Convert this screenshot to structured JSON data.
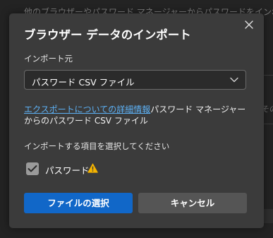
{
  "background": {
    "top_text": "他のブラウザーやパスワード マネージャーからパスワードをインポートする",
    "right_text": "その"
  },
  "dialog": {
    "title": "ブラウザー データのインポート",
    "close_icon": "close-icon",
    "source_label": "インポート元",
    "source_select": {
      "value": "パスワード CSV ファイル",
      "icon": "chevron-down-icon"
    },
    "description": {
      "link_text": "エクスポートについての詳細情報",
      "text": "パスワード マネージャーからのパスワード CSV ファイル"
    },
    "items_label": "インポートする項目を選択してください",
    "items": [
      {
        "label": "パスワード",
        "checked": true,
        "icon": "warning-icon"
      }
    ],
    "buttons": {
      "primary": "ファイルの選択",
      "secondary": "キャンセル"
    }
  },
  "colors": {
    "accent": "#1167c8",
    "link": "#5db1f5",
    "warning": "#f5b400",
    "dialog_bg": "#3b3b3b"
  }
}
